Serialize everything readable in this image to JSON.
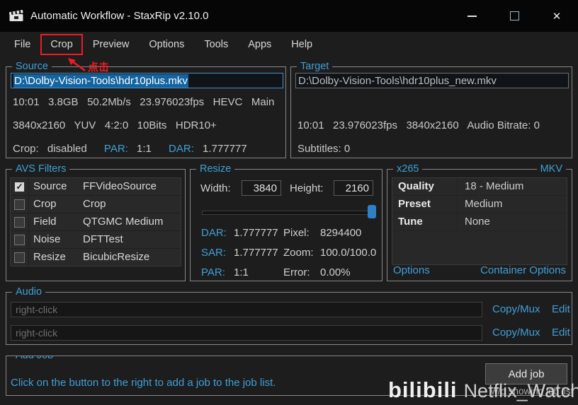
{
  "window": {
    "title": "Automatic Workflow - StaxRip v2.10.0"
  },
  "icons": {
    "close": "✕",
    "check": "✓"
  },
  "menu": {
    "items": [
      "File",
      "Crop",
      "Preview",
      "Options",
      "Tools",
      "Apps",
      "Help"
    ]
  },
  "annotation": {
    "text": "点击"
  },
  "source": {
    "title": "Source",
    "path": "D:\\Dolby-Vision-Tools\\hdr10plus.mkv",
    "line1": "10:01   3.8GB   50.2Mb/s   23.976023fps   HEVC   Main",
    "line2": "3840x2160   YUV   4:2:0   10Bits   HDR10+",
    "crop_label": "Crop:",
    "crop_value": "disabled",
    "par_label": "PAR:",
    "par_value": "1:1",
    "dar_label": "DAR:",
    "dar_value": "1.777777"
  },
  "target": {
    "title": "Target",
    "path": "D:\\Dolby-Vision-Tools\\hdr10plus_new.mkv",
    "line1": "10:01   23.976023fps   3840x2160   Audio Bitrate: 0",
    "line2": "Subtitles: 0"
  },
  "avs_filters": {
    "title": "AVS Filters",
    "rows": [
      {
        "checked": true,
        "name": "Source",
        "value": "FFVideoSource"
      },
      {
        "checked": false,
        "name": "Crop",
        "value": "Crop"
      },
      {
        "checked": false,
        "name": "Field",
        "value": "QTGMC Medium"
      },
      {
        "checked": false,
        "name": "Noise",
        "value": "DFTTest"
      },
      {
        "checked": false,
        "name": "Resize",
        "value": "BicubicResize"
      }
    ]
  },
  "resize": {
    "title": "Resize",
    "width_label": "Width:",
    "width_value": "3840",
    "height_label": "Height:",
    "height_value": "2160",
    "stats": [
      {
        "l1": "DAR:",
        "v1": "1.777777",
        "l2": "Pixel:",
        "v2": "8294400"
      },
      {
        "l1": "SAR:",
        "v1": "1.777777",
        "l2": "Zoom:",
        "v2": "100.0/100.0"
      },
      {
        "l1": "PAR:",
        "v1": "1:1",
        "l2": "Error:",
        "v2": "0.00%"
      }
    ]
  },
  "x265": {
    "title": "x265",
    "container": "MKV",
    "rows": [
      {
        "name": "Quality",
        "value": "18 - Medium"
      },
      {
        "name": "Preset",
        "value": "Medium"
      },
      {
        "name": "Tune",
        "value": "None"
      }
    ],
    "options_link": "Options",
    "container_options_link": "Container Options"
  },
  "audio": {
    "title": "Audio",
    "tracks": [
      {
        "placeholder": "right-click",
        "copy_mux": "Copy/Mux",
        "edit": "Edit"
      },
      {
        "placeholder": "right-click",
        "copy_mux": "Copy/Mux",
        "edit": "Edit"
      }
    ]
  },
  "add_job": {
    "title": "Add Job",
    "hint": "Click on the button to the right to add a job to the job list.",
    "button": "Add job",
    "button_sub": "w/o showing job list"
  },
  "watermark": {
    "brand": "bilibili",
    "name": "Netflix_Watcher"
  },
  "colors": {
    "accent": "#3fa0d8",
    "annotation": "#ed1c24",
    "selection": "#1464a0"
  }
}
